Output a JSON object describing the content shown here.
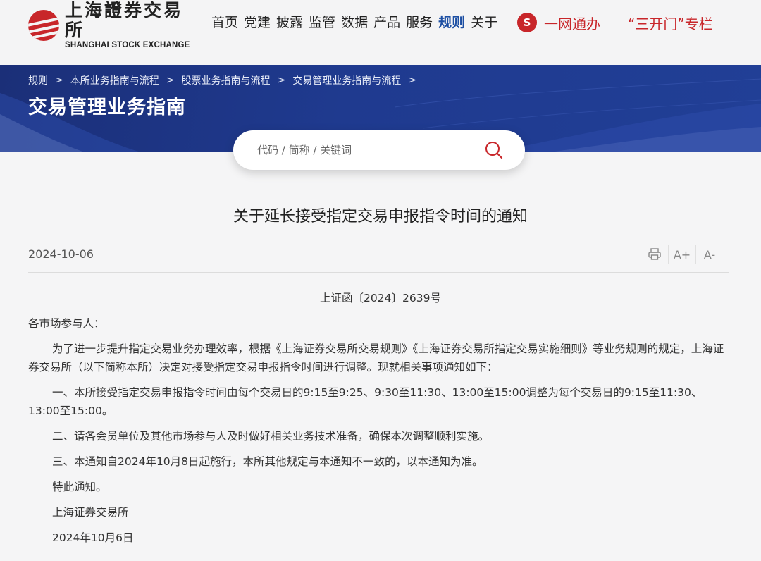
{
  "header": {
    "logo_cn": "上海證券交易所",
    "logo_en": "SHANGHAI STOCK EXCHANGE",
    "nav": [
      "首页",
      "党建",
      "披露",
      "监管",
      "数据",
      "产品",
      "服务",
      "规则",
      "关于"
    ],
    "active_nav": "规则",
    "yiwang_label": "一网通办",
    "sankaimen_label": "“三开门”专栏"
  },
  "banner": {
    "breadcrumb": [
      "规则",
      "本所业务指南与流程",
      "股票业务指南与流程",
      "交易管理业务指南与流程"
    ],
    "title": "交易管理业务指南"
  },
  "search": {
    "placeholder": "代码 / 简称 / 关键词"
  },
  "article": {
    "title": "关于延长接受指定交易申报指令时间的通知",
    "date": "2024-10-06",
    "tools": {
      "print_icon": "print-icon",
      "font_increase": "A+",
      "font_decrease": "A-"
    },
    "doc_number": "上证函〔2024〕2639号",
    "greeting": "各市场参与人：",
    "paragraphs": [
      "为了进一步提升指定交易业务办理效率，根据《上海证券交易所交易规则》《上海证券交易所指定交易实施细则》等业务规则的规定，上海证券交易所（以下简称本所）决定对接受指定交易申报指令时间进行调整。现就相关事项通知如下：",
      "一、本所接受指定交易申报指令时间由每个交易日的9:15至9:25、9:30至11:30、13:00至15:00调整为每个交易日的9:15至11:30、13:00至15:00。",
      "二、请各会员单位及其他市场参与人及时做好相关业务技术准备，确保本次调整顺利实施。",
      "三、本通知自2024年10月8日起施行，本所其他规定与本通知不一致的，以本通知为准。",
      "特此通知。"
    ],
    "signature": "上海证券交易所",
    "sign_date": "2024年10月6日"
  },
  "colors": {
    "brand_red": "#c8262a",
    "active_blue": "#1d4fa3",
    "banner_blue": "#1f3a8f"
  }
}
